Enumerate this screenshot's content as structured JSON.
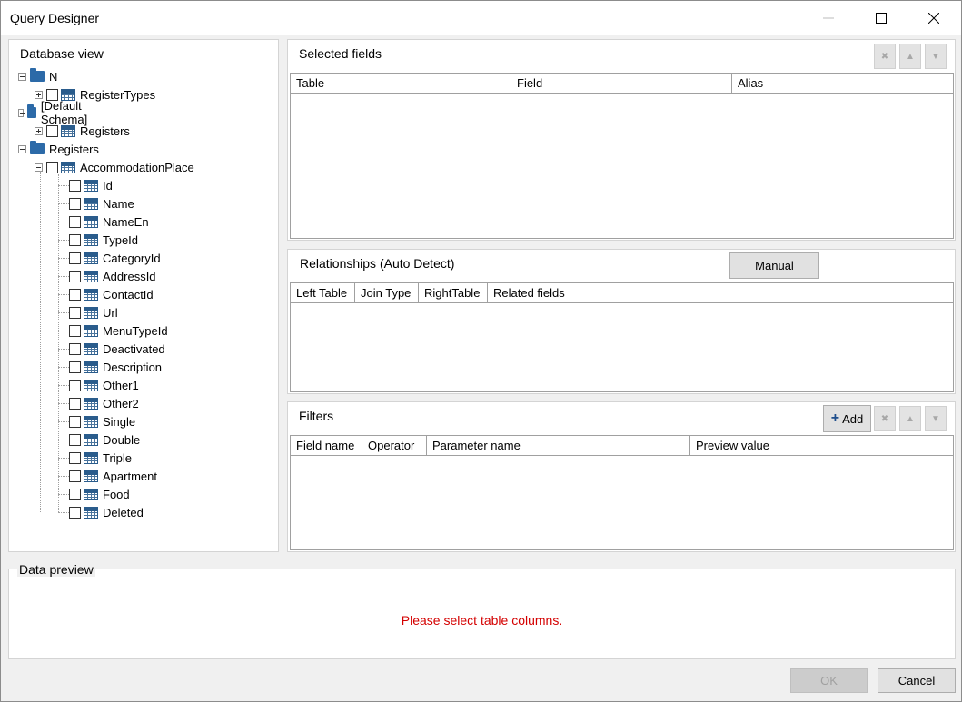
{
  "window": {
    "title": "Query Designer"
  },
  "database_view": {
    "title": "Database view",
    "tree": [
      {
        "label": "N",
        "kind": "folder",
        "state": "expanded"
      },
      {
        "label": "RegisterTypes",
        "kind": "table",
        "state": "collapsed"
      },
      {
        "label": "[Default Schema]",
        "kind": "folder",
        "state": "expanded"
      },
      {
        "label": "Registers",
        "kind": "table",
        "state": "collapsed"
      },
      {
        "label": "Registers",
        "kind": "folder",
        "state": "expanded"
      },
      {
        "label": "AccommodationPlace",
        "kind": "table",
        "state": "expanded"
      }
    ],
    "fields": [
      "Id",
      "Name",
      "NameEn",
      "TypeId",
      "CategoryId",
      "AddressId",
      "ContactId",
      "Url",
      "MenuTypeId",
      "Deactivated",
      "Description",
      "Other1",
      "Other2",
      "Single",
      "Double",
      "Triple",
      "Apartment",
      "Food",
      "Deleted"
    ]
  },
  "selected_fields": {
    "title": "Selected fields",
    "columns": [
      "Table",
      "Field",
      "Alias"
    ]
  },
  "relationships": {
    "title": "Relationships (Auto Detect)",
    "manual_label": "Manual",
    "columns": [
      "Left Table",
      "Join Type",
      "RightTable",
      "Related fields"
    ]
  },
  "filters": {
    "title": "Filters",
    "add_label": "Add",
    "columns": [
      "Field name",
      "Operator",
      "Parameter name",
      "Preview value"
    ]
  },
  "data_preview": {
    "title": "Data preview",
    "message": "Please select table columns."
  },
  "footer": {
    "ok_label": "OK",
    "cancel_label": "Cancel"
  },
  "colors": {
    "message": "#d40000",
    "folder": "#2c6aa8"
  }
}
